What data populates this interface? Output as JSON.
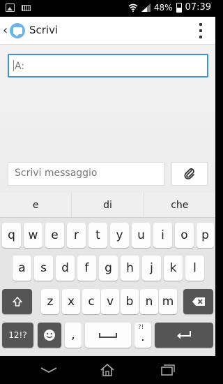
{
  "status": {
    "battery_percent": "48%",
    "time": "07:39",
    "icons": [
      "image-notification-icon",
      "keyboard-notification-icon",
      "wifi-icon",
      "signal-icon",
      "battery-icon"
    ]
  },
  "action_bar": {
    "back_icon": "chevron-left-icon",
    "app_icon": "messaging-app-icon",
    "title": "Scrivi",
    "menu_icon": "overflow-menu-icon"
  },
  "compose": {
    "to_placeholder": "A:",
    "message_placeholder": "Scrivi messaggio",
    "attach_icon": "paperclip-icon"
  },
  "keyboard": {
    "suggestions": [
      "e",
      "di",
      "che"
    ],
    "row1": [
      "q",
      "w",
      "e",
      "r",
      "t",
      "y",
      "u",
      "i",
      "o",
      "p"
    ],
    "row2": [
      "a",
      "s",
      "d",
      "f",
      "g",
      "h",
      "j",
      "k",
      "l"
    ],
    "row3": [
      "z",
      "x",
      "c",
      "v",
      "b",
      "n",
      "m"
    ],
    "shift_icon": "shift-arrow-icon",
    "backspace_icon": "backspace-icon",
    "symbols_label": "12!?",
    "emoji_icon": "smiley-icon",
    "comma": ",",
    "space_icon": "spacebar-icon",
    "period": ".",
    "period_hint": "?!",
    "enter_icon": "enter-arrow-icon"
  },
  "nav_bar": {
    "back_icon": "nav-back-icon",
    "home_icon": "nav-home-icon",
    "recents_icon": "nav-recents-icon"
  },
  "colors": {
    "accent": "#3d92d8",
    "app_icon": "#6cb3e8",
    "dark_key": "#555555"
  }
}
